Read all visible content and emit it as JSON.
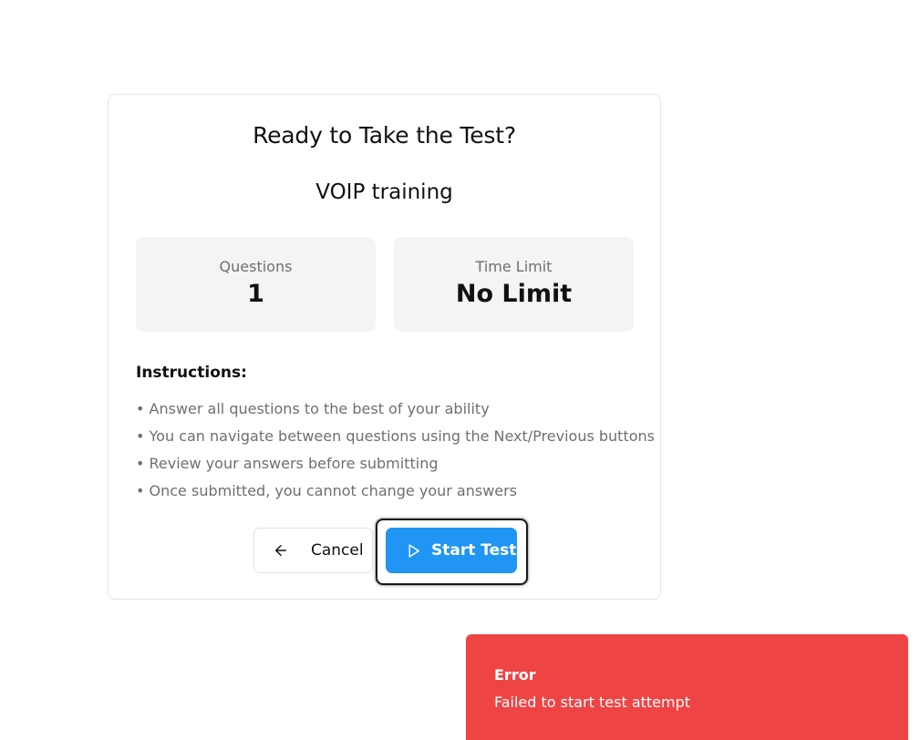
{
  "card": {
    "title": "Ready to Take the Test?",
    "test_name": "VOIP training",
    "stats": {
      "questions_label": "Questions",
      "questions_value": "1",
      "time_limit_label": "Time Limit",
      "time_limit_value": "No Limit"
    },
    "instructions": {
      "heading": "Instructions:",
      "items": [
        "• Answer all questions to the best of your ability",
        "• You can navigate between questions using the Next/Previous buttons",
        "• Review your answers before submitting",
        "• Once submitted, you cannot change your answers"
      ]
    },
    "actions": {
      "cancel_label": "Cancel",
      "start_label": "Start Test",
      "cancel_icon": "arrow-left-icon",
      "start_icon": "play-icon"
    }
  },
  "toast": {
    "title": "Error",
    "message": "Failed to start test attempt",
    "color": "#ef4444"
  },
  "colors": {
    "primary": "#2195f3",
    "stat_background": "#f4f4f2",
    "muted_text": "#6f6f6f"
  }
}
